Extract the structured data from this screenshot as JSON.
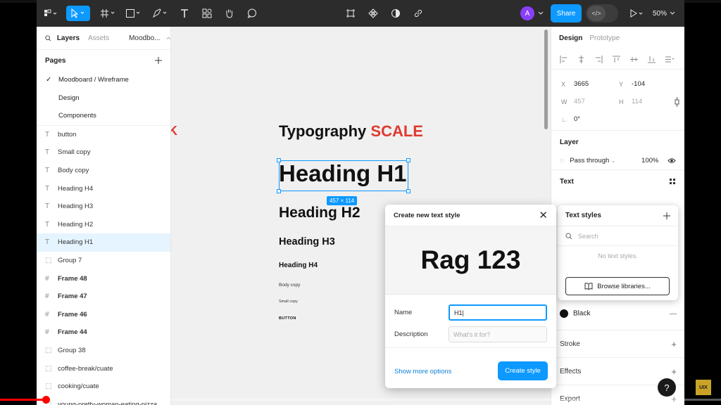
{
  "toolbar": {
    "avatar_initial": "A",
    "share_label": "Share",
    "dev_label": "</>",
    "zoom": "50%"
  },
  "left_panel": {
    "tabs": [
      "Layers",
      "Assets"
    ],
    "file_name": "Moodbo...",
    "pages_title": "Pages",
    "pages": [
      "Moodboard / Wireframe",
      "Design",
      "Components"
    ],
    "layers": [
      {
        "name": "button",
        "icon": "text-icon"
      },
      {
        "name": "Small copy",
        "icon": "text-icon"
      },
      {
        "name": "Body copy",
        "icon": "text-icon"
      },
      {
        "name": "Heading H4",
        "icon": "text-icon"
      },
      {
        "name": "Heading H3",
        "icon": "text-icon"
      },
      {
        "name": "Heading H2",
        "icon": "text-icon"
      },
      {
        "name": "Heading H1",
        "icon": "text-icon",
        "selected": true
      },
      {
        "name": "Group 7",
        "icon": "group-icon"
      },
      {
        "name": "Frame 48",
        "icon": "frame-icon"
      },
      {
        "name": "Frame 47",
        "icon": "frame-icon"
      },
      {
        "name": "Frame 46",
        "icon": "frame-icon"
      },
      {
        "name": "Frame 44",
        "icon": "frame-icon"
      },
      {
        "name": "Group 38",
        "icon": "group-icon"
      },
      {
        "name": "coffee-break/cuate",
        "icon": "group-icon"
      },
      {
        "name": "cooking/cuate",
        "icon": "group-icon"
      },
      {
        "name": "young-pretty-woman-eating-pizza...",
        "icon": "group-icon"
      }
    ]
  },
  "canvas": {
    "title_main": "Typography",
    "title_accent": "SCALE",
    "h1": "Heading H1",
    "selection_size": "457 × 114",
    "h2": "Heading H2",
    "h3": "Heading H3",
    "h4": "Heading H4",
    "body_copy": "Body copy",
    "small_copy": "Small copy",
    "button": "BUTTON",
    "accent_color": "#e03a2e"
  },
  "right_panel": {
    "tabs": [
      "Design",
      "Prototype"
    ],
    "x_label": "X",
    "x_value": "3665",
    "y_label": "Y",
    "y_value": "-104",
    "w_label": "W",
    "w_value": "457",
    "h_label": "H",
    "h_value": "114",
    "rotation": "0°",
    "layer_title": "Layer",
    "blend_mode": "Pass through",
    "opacity": "100%",
    "text_title": "Text",
    "fill_name": "Black",
    "stroke_title": "Stroke",
    "effects_title": "Effects",
    "export_title": "Export"
  },
  "text_styles": {
    "title": "Text styles",
    "search_placeholder": "Search",
    "empty": "No text styles.",
    "browse_label": "Browse libraries..."
  },
  "modal": {
    "title": "Create new text style",
    "preview": "Rag 123",
    "name_label": "Name",
    "name_value": "H1",
    "description_label": "Description",
    "description_placeholder": "What's it for?",
    "more_options": "Show more options",
    "create_label": "Create style"
  },
  "overlay": {
    "help": "?",
    "logo": "UIX",
    "progress": 0.063
  }
}
